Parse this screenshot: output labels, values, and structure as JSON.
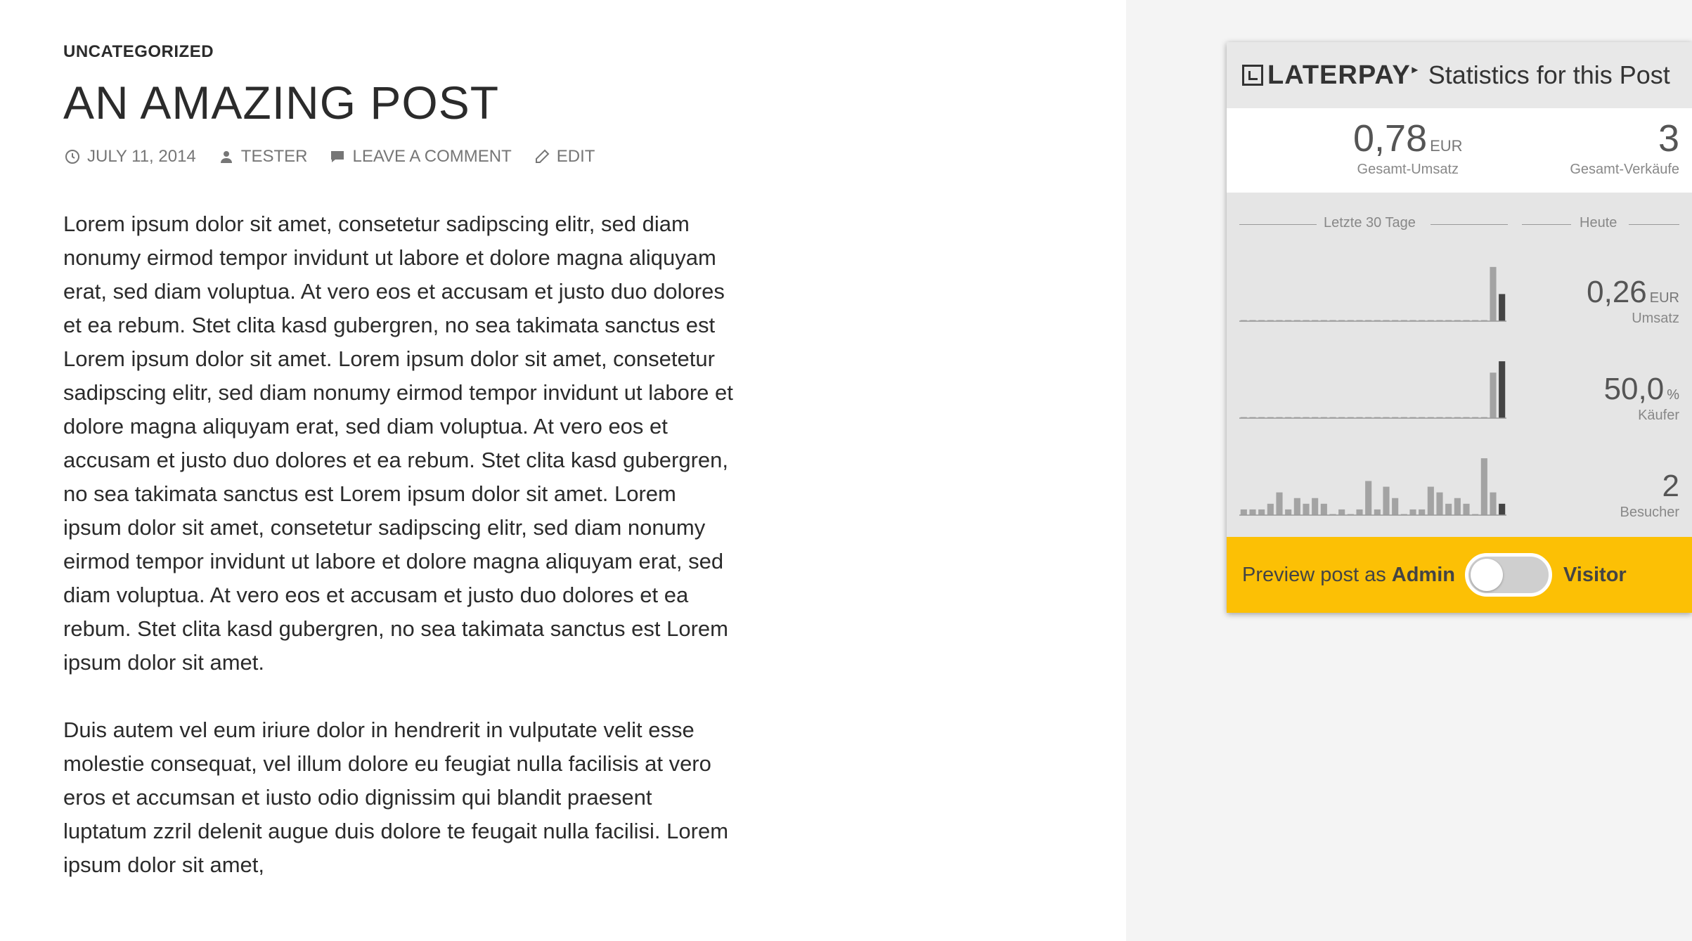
{
  "post": {
    "category": "UNCATEGORIZED",
    "title": "AN AMAZING POST",
    "meta": {
      "date": "JULY 11, 2014",
      "author": "TESTER",
      "comment": "LEAVE A COMMENT",
      "edit": "EDIT"
    },
    "paragraphs": [
      "Lorem ipsum dolor sit amet, consetetur sadipscing elitr, sed diam nonumy eirmod tempor invidunt ut labore et dolore magna aliquyam erat, sed diam voluptua. At vero eos et accusam et justo duo dolores et ea rebum. Stet clita kasd gubergren, no sea takimata sanctus est Lorem ipsum dolor sit amet. Lorem ipsum dolor sit amet, consetetur sadipscing elitr, sed diam nonumy eirmod tempor invidunt ut labore et dolore magna aliquyam erat, sed diam voluptua. At vero eos et accusam et justo duo dolores et ea rebum. Stet clita kasd gubergren, no sea takimata sanctus est Lorem ipsum dolor sit amet. Lorem ipsum dolor sit amet, consetetur sadipscing elitr, sed diam nonumy eirmod tempor invidunt ut labore et dolore magna aliquyam erat, sed diam voluptua. At vero eos et accusam et justo duo dolores et ea rebum. Stet clita kasd gubergren, no sea takimata sanctus est Lorem ipsum dolor sit amet.",
      "Duis autem vel eum iriure dolor in hendrerit in vulputate velit esse molestie consequat, vel illum dolore eu feugiat nulla facilisis at vero eros et accumsan et iusto odio dignissim qui blandit praesent luptatum zzril delenit augue duis dolore te feugait nulla facilisi. Lorem ipsum dolor sit amet,"
    ]
  },
  "panel": {
    "logo": "LATERPAY",
    "title": "Statistics for this Post",
    "totals": {
      "revenue_value": "0,78",
      "revenue_unit": "EUR",
      "revenue_label": "Gesamt-Umsatz",
      "sales_value": "3",
      "sales_label": "Gesamt-Verkäufe"
    },
    "section_last30": "Letzte 30 Tage",
    "section_today": "Heute",
    "metrics": [
      {
        "value": "0,26",
        "unit": "EUR",
        "label": "Umsatz"
      },
      {
        "value": "50,0",
        "unit": "%",
        "label": "Käufer"
      },
      {
        "value": "2",
        "unit": "",
        "label": "Besucher"
      }
    ],
    "preview": {
      "text": "Preview post as",
      "admin": "Admin",
      "visitor": "Visitor"
    }
  },
  "chart_data": [
    {
      "type": "bar",
      "series": [
        {
          "values": [
            0,
            0,
            0,
            0,
            0,
            0,
            0,
            0,
            0,
            0,
            0,
            0,
            0,
            0,
            0,
            0,
            0,
            0,
            0,
            0,
            0,
            0,
            0,
            0,
            0,
            0,
            0,
            0,
            0.52,
            0.26
          ]
        }
      ],
      "ylim": [
        0,
        0.6
      ]
    },
    {
      "type": "bar",
      "series": [
        {
          "values": [
            0,
            0,
            0,
            0,
            0,
            0,
            0,
            0,
            0,
            0,
            0,
            0,
            0,
            0,
            0,
            0,
            0,
            0,
            0,
            0,
            0,
            0,
            0,
            0,
            0,
            0,
            0,
            0,
            40,
            50
          ]
        }
      ],
      "ylim": [
        0,
        55
      ]
    },
    {
      "type": "bar",
      "series": [
        {
          "values": [
            1,
            1,
            1,
            2,
            4,
            1,
            3,
            2,
            3,
            2,
            0,
            1,
            0,
            1,
            6,
            1,
            5,
            3,
            0,
            1,
            1,
            5,
            4,
            2,
            3,
            2,
            0,
            10,
            4,
            2
          ]
        }
      ],
      "ylim": [
        0,
        11
      ]
    }
  ],
  "colors": {
    "accent": "#fcc005",
    "panel_bg": "#e5e5e5",
    "bar_past": "#a3a3a3",
    "bar_today": "#444444"
  }
}
